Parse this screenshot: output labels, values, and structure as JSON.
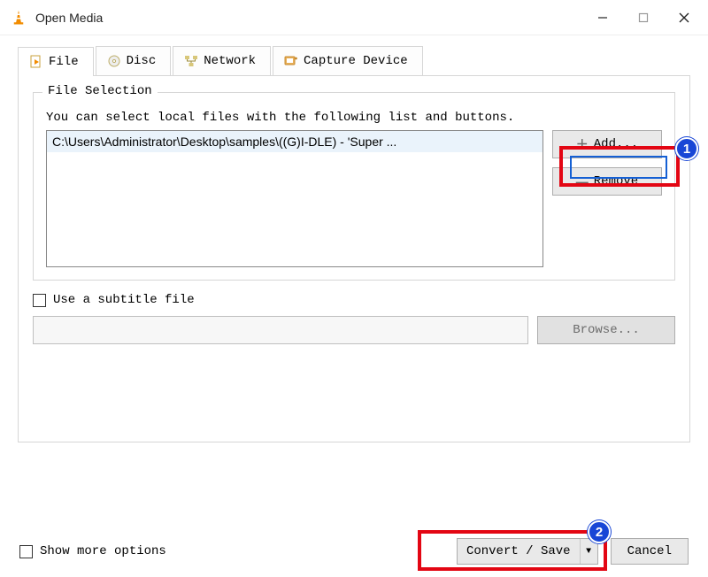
{
  "window": {
    "title": "Open Media"
  },
  "tabs": [
    {
      "label": "File",
      "active": true
    },
    {
      "label": "Disc",
      "active": false
    },
    {
      "label": "Network",
      "active": false
    },
    {
      "label": "Capture Device",
      "active": false
    }
  ],
  "file_selection": {
    "legend": "File Selection",
    "instruction": "You can select local files with the following list and buttons.",
    "files": [
      "C:\\Users\\Administrator\\Desktop\\samples\\((G)I-DLE) - 'Super ..."
    ],
    "add_label": "Add...",
    "remove_label": "Remove"
  },
  "subtitle": {
    "checkbox_label": "Use a subtitle file",
    "browse_label": "Browse...",
    "checked": false
  },
  "footer": {
    "show_more_label": "Show more options",
    "show_more_checked": false,
    "convert_label": "Convert / Save",
    "cancel_label": "Cancel"
  },
  "annotations": {
    "badge1": "1",
    "badge2": "2"
  }
}
